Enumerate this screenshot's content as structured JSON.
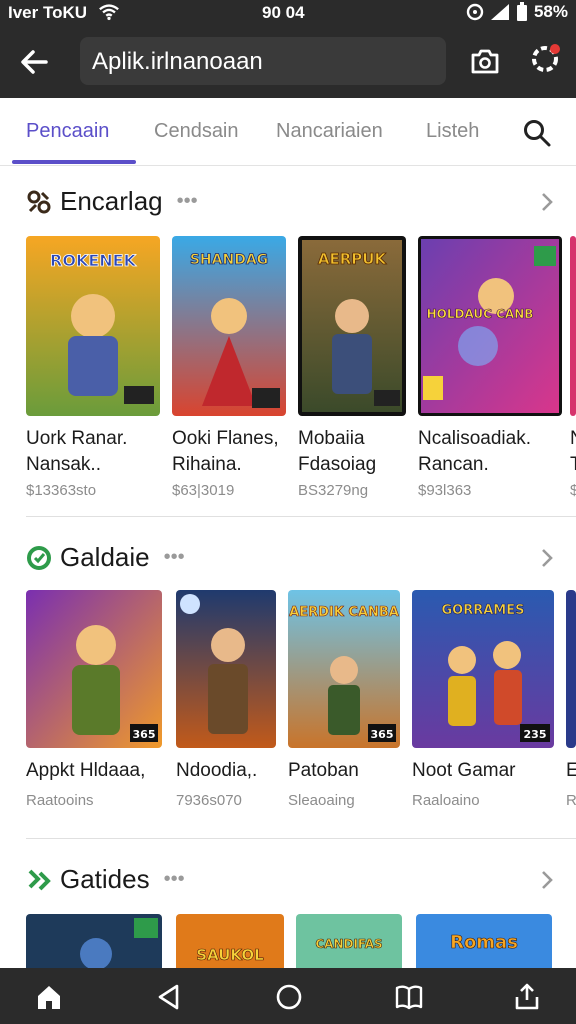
{
  "status_bar": {
    "carrier": "Iver ToKU",
    "time": "90 04",
    "battery": "58%"
  },
  "app_bar": {
    "search_text": "Aplik.irlnanoaan"
  },
  "tabs": [
    "Pencaain",
    "Cendsain",
    "Nancariaien",
    "Listeh"
  ],
  "sections": [
    {
      "title": "Encarlag",
      "cards": [
        {
          "title_art": "ROKENEK",
          "name1": "Uork Ranar.",
          "name2": "Nansak..",
          "sub": "$13363sto"
        },
        {
          "title_art": "SHANDAG",
          "name1": "Ooki Flanes,",
          "name2": "Rihaina.",
          "sub": "$63|3019"
        },
        {
          "title_art": "AERPUK",
          "name1": "Mobaiia",
          "name2": "Fdasoiag",
          "sub": "BS3279ng"
        },
        {
          "title_art": "HOLDAUC CANB",
          "name1": "Ncalisoadiak.",
          "name2": "Rancan.",
          "sub": "$93l363"
        },
        {
          "title_art": "",
          "name1": "N",
          "name2": "T",
          "sub": "$"
        }
      ]
    },
    {
      "title": "Galdaie",
      "cards": [
        {
          "title_art": "",
          "badge": "365",
          "name1": "Appkt Hldaaa,",
          "sub": "Raatooins"
        },
        {
          "title_art": "",
          "badge": "",
          "name1": "Ndoodia,.",
          "sub": "7936s070"
        },
        {
          "title_art": "AERDIK CANBA",
          "badge": "365",
          "name1": "Patoban",
          "sub": "Sleaoaing"
        },
        {
          "title_art": "GORRAMES",
          "badge": "235",
          "name1": "Noot Gamar",
          "sub": "Raaloaino"
        },
        {
          "title_art": "",
          "badge": "",
          "name1": "E",
          "sub": "R"
        }
      ]
    },
    {
      "title": "Gatides",
      "cards": [
        {
          "title_art": ""
        },
        {
          "title_art": "SAUKOL"
        },
        {
          "title_art": "CANDIFAS"
        },
        {
          "title_art": "Romas"
        }
      ]
    }
  ],
  "colors": {
    "accent": "#5b4fc9",
    "bar": "#2b2b2b"
  }
}
